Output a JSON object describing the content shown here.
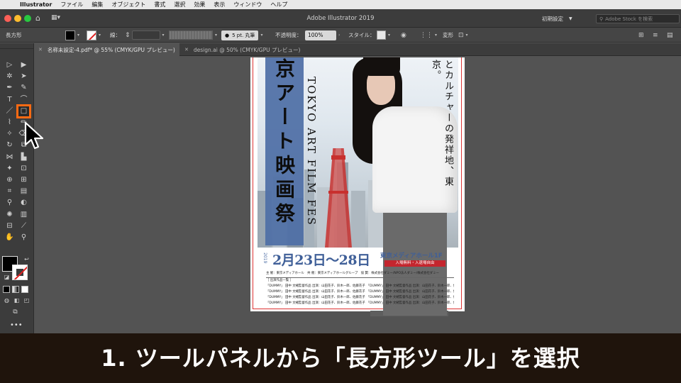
{
  "menubar": {
    "app": "Illustrator",
    "items": [
      "ファイル",
      "編集",
      "オブジェクト",
      "書式",
      "選択",
      "効果",
      "表示",
      "ウィンドウ",
      "ヘルプ"
    ]
  },
  "titlebar": {
    "title": "Adobe Illustrator 2019",
    "workspace": "初期設定",
    "stock_placeholder": "Adobe Stock を検索"
  },
  "controlbar": {
    "object_type": "長方形",
    "stroke_label": "線：",
    "brush": "5 pt. 丸筆",
    "opacity_label": "不透明度：",
    "opacity_value": "100%",
    "style_label": "スタイル：",
    "transform_label": "変形"
  },
  "tabs": [
    {
      "label": "名称未設定-4.pdf* @ 55% (CMYK/GPU プレビュー)"
    },
    {
      "label": "design.ai @ 50% (CMYK/GPU プレビュー)"
    }
  ],
  "tools": {
    "selected": "rectangle-tool",
    "items": [
      {
        "name": "selection-tool-icon",
        "glyph": "▷"
      },
      {
        "name": "direct-selection-tool-icon",
        "glyph": "▶"
      },
      {
        "name": "magic-wand-tool-icon",
        "glyph": "✲"
      },
      {
        "name": "lasso-tool-icon",
        "glyph": "➤"
      },
      {
        "name": "pen-tool-icon",
        "glyph": "✒"
      },
      {
        "name": "curvature-tool-icon",
        "glyph": "✎"
      },
      {
        "name": "type-tool-icon",
        "glyph": "T"
      },
      {
        "name": "arc-tool-icon",
        "glyph": "⌒"
      },
      {
        "name": "line-tool-icon",
        "glyph": "／"
      },
      {
        "name": "rectangle-tool-icon",
        "glyph": "□"
      },
      {
        "name": "paintbrush-tool-icon",
        "glyph": "⌇"
      },
      {
        "name": "pencil-tool-icon",
        "glyph": "✏"
      },
      {
        "name": "blob-brush-tool-icon",
        "glyph": "✧"
      },
      {
        "name": "eraser-tool-icon",
        "glyph": "⌫"
      },
      {
        "name": "rotate-tool-icon",
        "glyph": "↻"
      },
      {
        "name": "scale-tool-icon",
        "glyph": "⧉"
      },
      {
        "name": "width-tool-icon",
        "glyph": "⋈"
      },
      {
        "name": "warp-tool-icon",
        "glyph": "▙"
      },
      {
        "name": "puppet-warp-tool-icon",
        "glyph": "✦"
      },
      {
        "name": "free-transform-tool-icon",
        "glyph": "⊡"
      },
      {
        "name": "shape-builder-tool-icon",
        "glyph": "⊕"
      },
      {
        "name": "perspective-grid-tool-icon",
        "glyph": "⊞"
      },
      {
        "name": "mesh-tool-icon",
        "glyph": "⌗"
      },
      {
        "name": "gradient-tool-icon",
        "glyph": "▤"
      },
      {
        "name": "eyedropper-tool-icon",
        "glyph": "⚲"
      },
      {
        "name": "blend-tool-icon",
        "glyph": "◐"
      },
      {
        "name": "symbol-sprayer-tool-icon",
        "glyph": "✺"
      },
      {
        "name": "column-graph-tool-icon",
        "glyph": "▥"
      },
      {
        "name": "artboard-tool-icon",
        "glyph": "⊟"
      },
      {
        "name": "slice-tool-icon",
        "glyph": "⟋"
      },
      {
        "name": "hand-tool-icon",
        "glyph": "✋"
      },
      {
        "name": "zoom-tool-icon",
        "glyph": "⚲"
      }
    ]
  },
  "poster": {
    "title_vertical": "京アート映画祭",
    "subtitle_vertical": "TOKYO ART FILM FES",
    "tagline_vertical": "とカルチャーの発祥地、東京。",
    "year": "2019",
    "dates": "2月23日～28日",
    "venue": "東京メディアホール1F",
    "admission": "入場無料・入退場自由",
    "credits_line1": "主 催：東京メディアホール　共 催：東京メディアホールグループ　協 賛：株式会社ダミー/NPO法人ダミー/株式会社ダミー",
    "credits_header": "［ 出演作品一覧 ］",
    "credits_rows": [
      "「DUMMY」 田中 文緒監督作品 出演：山田花子、鈴木一郎、佐藤花子　「DUMMY」 田中 文緒監督作品 出演：山田花子、鈴木一郎、佐藤花子　「DUMMY」 田中 文緒監督作品 出演：山田花子、鈴木一郎、佐藤花子",
      "「DUMMY」 田中 文緒監督作品 出演：山田花子、鈴木一郎、佐藤花子　「DUMMY」 田中 文緒監督作品 出演：山田花子、鈴木一郎、佐藤花子　「DUMMY」 田中 文緒監督作品 出演：山田花子、鈴木一郎、佐藤花子",
      "「DUMMY」 田中 文緒監督作品 出演：山田花子、鈴木一郎、佐藤花子　「DUMMY」 田中 文緒監督作品 出演：山田花子、鈴木一郎、佐藤花子　「DUMMY」 田中 文緒監督作品 出演：山田花子、鈴木一郎、佐藤花子",
      "「DUMMY」 田中 文緒監督作品 出演：山田花子、鈴木一郎、佐藤花子　「DUMMY」 田中 文緒監督作品 出演：山田花子、鈴木一郎、佐藤花子　「DUMMY」 田中 文緒監督作品 出演：山田花子、鈴木一郎、佐藤花子"
    ]
  },
  "caption": "1. ツールパネルから「長方形ツール」を選択",
  "colors": {
    "accent_orange": "#ff6a13",
    "poster_blue": "#4f6fa6",
    "poster_red": "#c4262e",
    "caption_bg": "#1f140c"
  }
}
